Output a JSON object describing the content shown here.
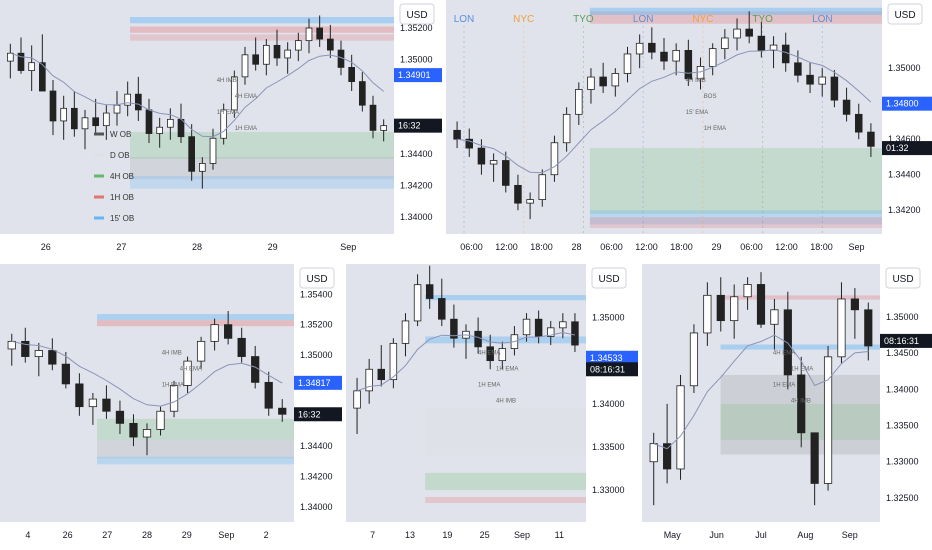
{
  "colors": {
    "bg": "#e0e3eb",
    "candle_up": "#ffffff",
    "candle_down": "#222222",
    "ob_w": "#555555",
    "ob_d": "#dde0e8",
    "ob_4h": "#66bb6a",
    "ob_1h": "#e57373",
    "ob_15": "#64b5f6",
    "price_tag": "#2962ff",
    "time_tag": "#131722",
    "ema": "#8c94b8",
    "session_lon": "#5b8fd9",
    "session_nyc": "#f0a040",
    "session_tyo": "#5aa05a"
  },
  "common": {
    "currency": "USD"
  },
  "legend": [
    {
      "label": "W OB",
      "color": "#555555"
    },
    {
      "label": "D OB",
      "color": "#dde0e8"
    },
    {
      "label": "4H OB",
      "color": "#66bb6a"
    },
    {
      "label": "1H OB",
      "color": "#e57373"
    },
    {
      "label": "15' OB",
      "color": "#64b5f6"
    }
  ],
  "chart_data": [
    {
      "id": "p1",
      "type": "candlestick",
      "yticks": [
        "1.35200",
        "1.35000",
        "1.34600",
        "1.34400",
        "1.34200",
        "1.34000"
      ],
      "yrange": [
        1.3393,
        1.3534
      ],
      "xticks": [
        "26",
        "27",
        "28",
        "29",
        "Sep"
      ],
      "price_tag": "1.34901",
      "price_value": 1.34901,
      "time_tag": "16:32",
      "time_value": 1.3458,
      "annotations": [
        "4H IMB",
        "4H EMA",
        "1H EMA",
        "1H EMA"
      ],
      "candles": [
        [
          1.3499,
          1.351,
          1.3488,
          1.3504
        ],
        [
          1.3504,
          1.3514,
          1.3491,
          1.3493
        ],
        [
          1.3493,
          1.3509,
          1.348,
          1.3498
        ],
        [
          1.3498,
          1.3516,
          1.3489,
          1.348
        ],
        [
          1.348,
          1.3487,
          1.3452,
          1.3461
        ],
        [
          1.3461,
          1.3477,
          1.3449,
          1.3469
        ],
        [
          1.3469,
          1.348,
          1.3451,
          1.3456
        ],
        [
          1.3456,
          1.3468,
          1.3443,
          1.3463
        ],
        [
          1.3463,
          1.3475,
          1.3452,
          1.3458
        ],
        [
          1.3458,
          1.3471,
          1.3449,
          1.3466
        ],
        [
          1.3466,
          1.348,
          1.3458,
          1.3471
        ],
        [
          1.3471,
          1.3486,
          1.3464,
          1.3478
        ],
        [
          1.3478,
          1.3489,
          1.3461,
          1.3468
        ],
        [
          1.3468,
          1.3475,
          1.3447,
          1.3453
        ],
        [
          1.3453,
          1.3463,
          1.3444,
          1.3457
        ],
        [
          1.3457,
          1.3469,
          1.3449,
          1.3462
        ],
        [
          1.3462,
          1.3472,
          1.3447,
          1.3451
        ],
        [
          1.3451,
          1.3459,
          1.3423,
          1.3429
        ],
        [
          1.3429,
          1.3438,
          1.3418,
          1.3434
        ],
        [
          1.3434,
          1.3456,
          1.343,
          1.345
        ],
        [
          1.345,
          1.3472,
          1.3446,
          1.3468
        ],
        [
          1.3468,
          1.3493,
          1.3463,
          1.3489
        ],
        [
          1.3489,
          1.3508,
          1.3484,
          1.3503
        ],
        [
          1.3503,
          1.3514,
          1.3493,
          1.3497
        ],
        [
          1.3497,
          1.3513,
          1.349,
          1.3509
        ],
        [
          1.3509,
          1.3519,
          1.3496,
          1.3501
        ],
        [
          1.3501,
          1.3511,
          1.3491,
          1.3506
        ],
        [
          1.3506,
          1.3517,
          1.3499,
          1.3512
        ],
        [
          1.3512,
          1.3526,
          1.3504,
          1.352
        ],
        [
          1.352,
          1.3528,
          1.3508,
          1.3513
        ],
        [
          1.3513,
          1.3522,
          1.3501,
          1.3506
        ],
        [
          1.3506,
          1.3512,
          1.349,
          1.3495
        ],
        [
          1.3495,
          1.3503,
          1.348,
          1.3486
        ],
        [
          1.3486,
          1.3492,
          1.3467,
          1.3471
        ],
        [
          1.3471,
          1.3477,
          1.345,
          1.3455
        ],
        [
          1.3455,
          1.3462,
          1.3448,
          1.3458
        ]
      ]
    },
    {
      "id": "p2",
      "type": "candlestick",
      "yticks": [
        "1.35000",
        "1.34600",
        "1.34400",
        "1.34200"
      ],
      "yrange": [
        1.341,
        1.3535
      ],
      "xticks": [
        "06:00",
        "12:00",
        "18:00",
        "28",
        "06:00",
        "12:00",
        "18:00",
        "29",
        "06:00",
        "12:00",
        "18:00",
        "Sep"
      ],
      "price_tag": "1.34800",
      "price_value": 1.348,
      "time_tag": "01:32",
      "time_value": 1.3455,
      "sessions": [
        {
          "label": "LON",
          "kind": "lon"
        },
        {
          "label": "NYC",
          "kind": "nyc"
        },
        {
          "label": "TYO",
          "kind": "tyo"
        },
        {
          "label": "LON",
          "kind": "lon"
        },
        {
          "label": "NYC",
          "kind": "nyc"
        },
        {
          "label": "TYO",
          "kind": "tyo"
        },
        {
          "label": "LON",
          "kind": "lon"
        }
      ],
      "annotations": [
        "4H IMB",
        "BOS",
        "15' EMA",
        "1H EMA"
      ],
      "candles": [
        [
          1.3465,
          1.347,
          1.3455,
          1.346
        ],
        [
          1.346,
          1.3466,
          1.345,
          1.3455
        ],
        [
          1.3455,
          1.346,
          1.344,
          1.3446
        ],
        [
          1.3446,
          1.3452,
          1.3436,
          1.3448
        ],
        [
          1.3448,
          1.3453,
          1.343,
          1.3434
        ],
        [
          1.3434,
          1.344,
          1.342,
          1.3424
        ],
        [
          1.3424,
          1.343,
          1.3415,
          1.3426
        ],
        [
          1.3426,
          1.3443,
          1.3422,
          1.344
        ],
        [
          1.344,
          1.3462,
          1.3436,
          1.3458
        ],
        [
          1.3458,
          1.3478,
          1.3453,
          1.3474
        ],
        [
          1.3474,
          1.3492,
          1.3468,
          1.3488
        ],
        [
          1.3488,
          1.35,
          1.348,
          1.3495
        ],
        [
          1.3495,
          1.3503,
          1.3486,
          1.349
        ],
        [
          1.349,
          1.35,
          1.3484,
          1.3497
        ],
        [
          1.3497,
          1.3512,
          1.3492,
          1.3508
        ],
        [
          1.3508,
          1.3519,
          1.35,
          1.3514
        ],
        [
          1.3514,
          1.3523,
          1.3505,
          1.3509
        ],
        [
          1.3509,
          1.3517,
          1.3499,
          1.3504
        ],
        [
          1.3504,
          1.3514,
          1.3496,
          1.351
        ],
        [
          1.351,
          1.3516,
          1.349,
          1.3494
        ],
        [
          1.3494,
          1.3506,
          1.3488,
          1.3501
        ],
        [
          1.3501,
          1.3514,
          1.3496,
          1.3511
        ],
        [
          1.3511,
          1.3522,
          1.3505,
          1.3517
        ],
        [
          1.3517,
          1.3528,
          1.351,
          1.3522
        ],
        [
          1.3522,
          1.3532,
          1.3514,
          1.3518
        ],
        [
          1.3518,
          1.3526,
          1.3506,
          1.351
        ],
        [
          1.351,
          1.3518,
          1.35,
          1.3513
        ],
        [
          1.3513,
          1.352,
          1.3498,
          1.3503
        ],
        [
          1.3503,
          1.351,
          1.3492,
          1.3496
        ],
        [
          1.3496,
          1.3503,
          1.3486,
          1.3491
        ],
        [
          1.3491,
          1.35,
          1.3484,
          1.3495
        ],
        [
          1.3495,
          1.3499,
          1.3478,
          1.3482
        ],
        [
          1.3482,
          1.3489,
          1.347,
          1.3474
        ],
        [
          1.3474,
          1.348,
          1.346,
          1.3464
        ],
        [
          1.3464,
          1.3469,
          1.345,
          1.3456
        ]
      ]
    },
    {
      "id": "p3",
      "type": "candlestick",
      "yticks": [
        "1.35400",
        "1.35200",
        "1.35000",
        "1.34817",
        "1.34400",
        "1.34200",
        "1.34000"
      ],
      "yrange": [
        1.3394,
        1.3556
      ],
      "xticks": [
        "4",
        "26",
        "27",
        "28",
        "29",
        "Sep",
        "2"
      ],
      "price_tag": "1.34817",
      "price_value": 1.34817,
      "time_tag": "16:32",
      "time_value": 1.3461,
      "annotations": [
        "4H IMB",
        "4H EMA",
        "1H EMA"
      ],
      "candles": [
        [
          1.3504,
          1.3514,
          1.3493,
          1.3509
        ],
        [
          1.3509,
          1.3518,
          1.3495,
          1.3499
        ],
        [
          1.3499,
          1.3508,
          1.3486,
          1.3503
        ],
        [
          1.3503,
          1.3511,
          1.349,
          1.3494
        ],
        [
          1.3494,
          1.3502,
          1.3478,
          1.3481
        ],
        [
          1.3481,
          1.3488,
          1.346,
          1.3466
        ],
        [
          1.3466,
          1.3475,
          1.3454,
          1.3471
        ],
        [
          1.3471,
          1.348,
          1.3458,
          1.3463
        ],
        [
          1.3463,
          1.347,
          1.3448,
          1.3455
        ],
        [
          1.3455,
          1.3461,
          1.344,
          1.3446
        ],
        [
          1.3446,
          1.3455,
          1.3434,
          1.3451
        ],
        [
          1.3451,
          1.3466,
          1.3447,
          1.3463
        ],
        [
          1.3463,
          1.3483,
          1.3459,
          1.348
        ],
        [
          1.348,
          1.3499,
          1.3475,
          1.3496
        ],
        [
          1.3496,
          1.3512,
          1.3491,
          1.3509
        ],
        [
          1.3509,
          1.3524,
          1.3503,
          1.352
        ],
        [
          1.352,
          1.3529,
          1.3507,
          1.3511
        ],
        [
          1.3511,
          1.3518,
          1.3495,
          1.3499
        ],
        [
          1.3499,
          1.3506,
          1.3478,
          1.3482
        ],
        [
          1.3482,
          1.3489,
          1.346,
          1.3465
        ],
        [
          1.3465,
          1.3471,
          1.3456,
          1.3461
        ]
      ]
    },
    {
      "id": "p4",
      "type": "candlestick",
      "yticks": [
        "1.35000",
        "1.34533",
        "1.34000",
        "1.33500",
        "1.33000"
      ],
      "yrange": [
        1.327,
        1.3555
      ],
      "xticks": [
        "7",
        "13",
        "19",
        "25",
        "Sep",
        "11"
      ],
      "price_tag": "1.34533",
      "price_value": 1.34533,
      "time_tag": "08:16:31",
      "time_value": 1.344,
      "annotations": [
        "4H EMA",
        "1H EMA",
        "1H EMA",
        "4H IMB"
      ],
      "candles": [
        [
          1.3395,
          1.343,
          1.3365,
          1.3415
        ],
        [
          1.3415,
          1.3452,
          1.34,
          1.344
        ],
        [
          1.344,
          1.3468,
          1.342,
          1.3428
        ],
        [
          1.3428,
          1.3476,
          1.3418,
          1.347
        ],
        [
          1.347,
          1.3505,
          1.3455,
          1.3496
        ],
        [
          1.3496,
          1.355,
          1.349,
          1.3538
        ],
        [
          1.3538,
          1.356,
          1.351,
          1.3522
        ],
        [
          1.3522,
          1.3545,
          1.349,
          1.3498
        ],
        [
          1.3498,
          1.3515,
          1.3465,
          1.3476
        ],
        [
          1.3476,
          1.3492,
          1.3452,
          1.3484
        ],
        [
          1.3484,
          1.35,
          1.3458,
          1.3466
        ],
        [
          1.3466,
          1.348,
          1.344,
          1.345
        ],
        [
          1.345,
          1.3472,
          1.344,
          1.3464
        ],
        [
          1.3464,
          1.349,
          1.3456,
          1.348
        ],
        [
          1.348,
          1.3505,
          1.3472,
          1.3498
        ],
        [
          1.3498,
          1.3508,
          1.347,
          1.3478
        ],
        [
          1.3478,
          1.3496,
          1.3468,
          1.3488
        ],
        [
          1.3488,
          1.3505,
          1.3476,
          1.3495
        ],
        [
          1.3495,
          1.3505,
          1.346,
          1.3468
        ]
      ]
    },
    {
      "id": "p5",
      "type": "candlestick",
      "yticks": [
        "1.35500",
        "1.35000",
        "1.34500",
        "1.34000",
        "1.33500",
        "1.33000",
        "1.32500"
      ],
      "yrange": [
        1.3225,
        1.3565
      ],
      "xticks": [
        "May",
        "Jun",
        "Jul",
        "Aug",
        "Sep"
      ],
      "price_tag": "08:16:31",
      "price_value": 1.3467,
      "annotations": [
        "4H EMA",
        "1H EMA",
        "1H EMA",
        "4H IMB"
      ],
      "candles": [
        [
          1.33,
          1.334,
          1.324,
          1.3325
        ],
        [
          1.3325,
          1.338,
          1.327,
          1.329
        ],
        [
          1.329,
          1.342,
          1.3275,
          1.3405
        ],
        [
          1.3405,
          1.349,
          1.3395,
          1.3478
        ],
        [
          1.3478,
          1.3548,
          1.346,
          1.353
        ],
        [
          1.353,
          1.3555,
          1.348,
          1.3495
        ],
        [
          1.3495,
          1.3545,
          1.347,
          1.3528
        ],
        [
          1.3528,
          1.3555,
          1.351,
          1.3545
        ],
        [
          1.3545,
          1.3562,
          1.3485,
          1.349
        ],
        [
          1.349,
          1.3525,
          1.3455,
          1.351
        ],
        [
          1.351,
          1.3535,
          1.34,
          1.342
        ],
        [
          1.342,
          1.3445,
          1.332,
          1.334
        ],
        [
          1.334,
          1.334,
          1.324,
          1.327
        ],
        [
          1.327,
          1.346,
          1.326,
          1.3445
        ],
        [
          1.3445,
          1.3548,
          1.3435,
          1.3525
        ],
        [
          1.3525,
          1.354,
          1.347,
          1.351
        ],
        [
          1.351,
          1.352,
          1.344,
          1.346
        ]
      ]
    }
  ]
}
